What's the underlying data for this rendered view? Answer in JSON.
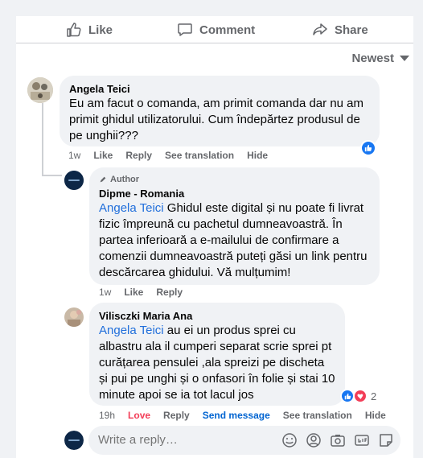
{
  "actions": {
    "like": "Like",
    "comment": "Comment",
    "share": "Share"
  },
  "sort": {
    "label": "Newest"
  },
  "comments": [
    {
      "author": "Angela Teici",
      "text": "Eu am facut o comanda, am primit comanda dar nu am primit ghidul utilizatorului. Cum îndepărtez produsul de pe unghii???",
      "time": "1w",
      "like": "Like",
      "reply": "Reply",
      "translate": "See translation",
      "hide": "Hide"
    },
    {
      "badge": "Author",
      "author": "Dipme - Romania",
      "mention": "Angela Teici",
      "text": " Ghidul este digital și nu poate fi livrat fizic împreună cu pachetul dumneavoastră. În partea inferioară a e-mailului de confirmare a comenzii dumneavoastră puteți găsi un link pentru descărcarea ghidului. Vă mulțumim!",
      "time": "1w",
      "like": "Like",
      "reply": "Reply"
    },
    {
      "author": "Vilisczki Maria Ana",
      "mention": "Angela Teici",
      "text": " au ei un produs sprei cu albastru ala il cumperi separat scrie sprei pt curățarea pensulei ,ala spreizi pe discheta și pui pe unghi și o onfasori în folie și stai 10 minute apoi se ia tot lacul jos",
      "time": "19h",
      "love": "Love",
      "reply": "Reply",
      "send": "Send message",
      "translate": "See translation",
      "hide": "Hide",
      "reaction_count": "2"
    }
  ],
  "reply_box": {
    "placeholder": "Write a reply…"
  },
  "colors": {
    "link": "#216fdb",
    "accent": "#1877f2",
    "love": "#f33e58",
    "muted": "#65676b"
  }
}
